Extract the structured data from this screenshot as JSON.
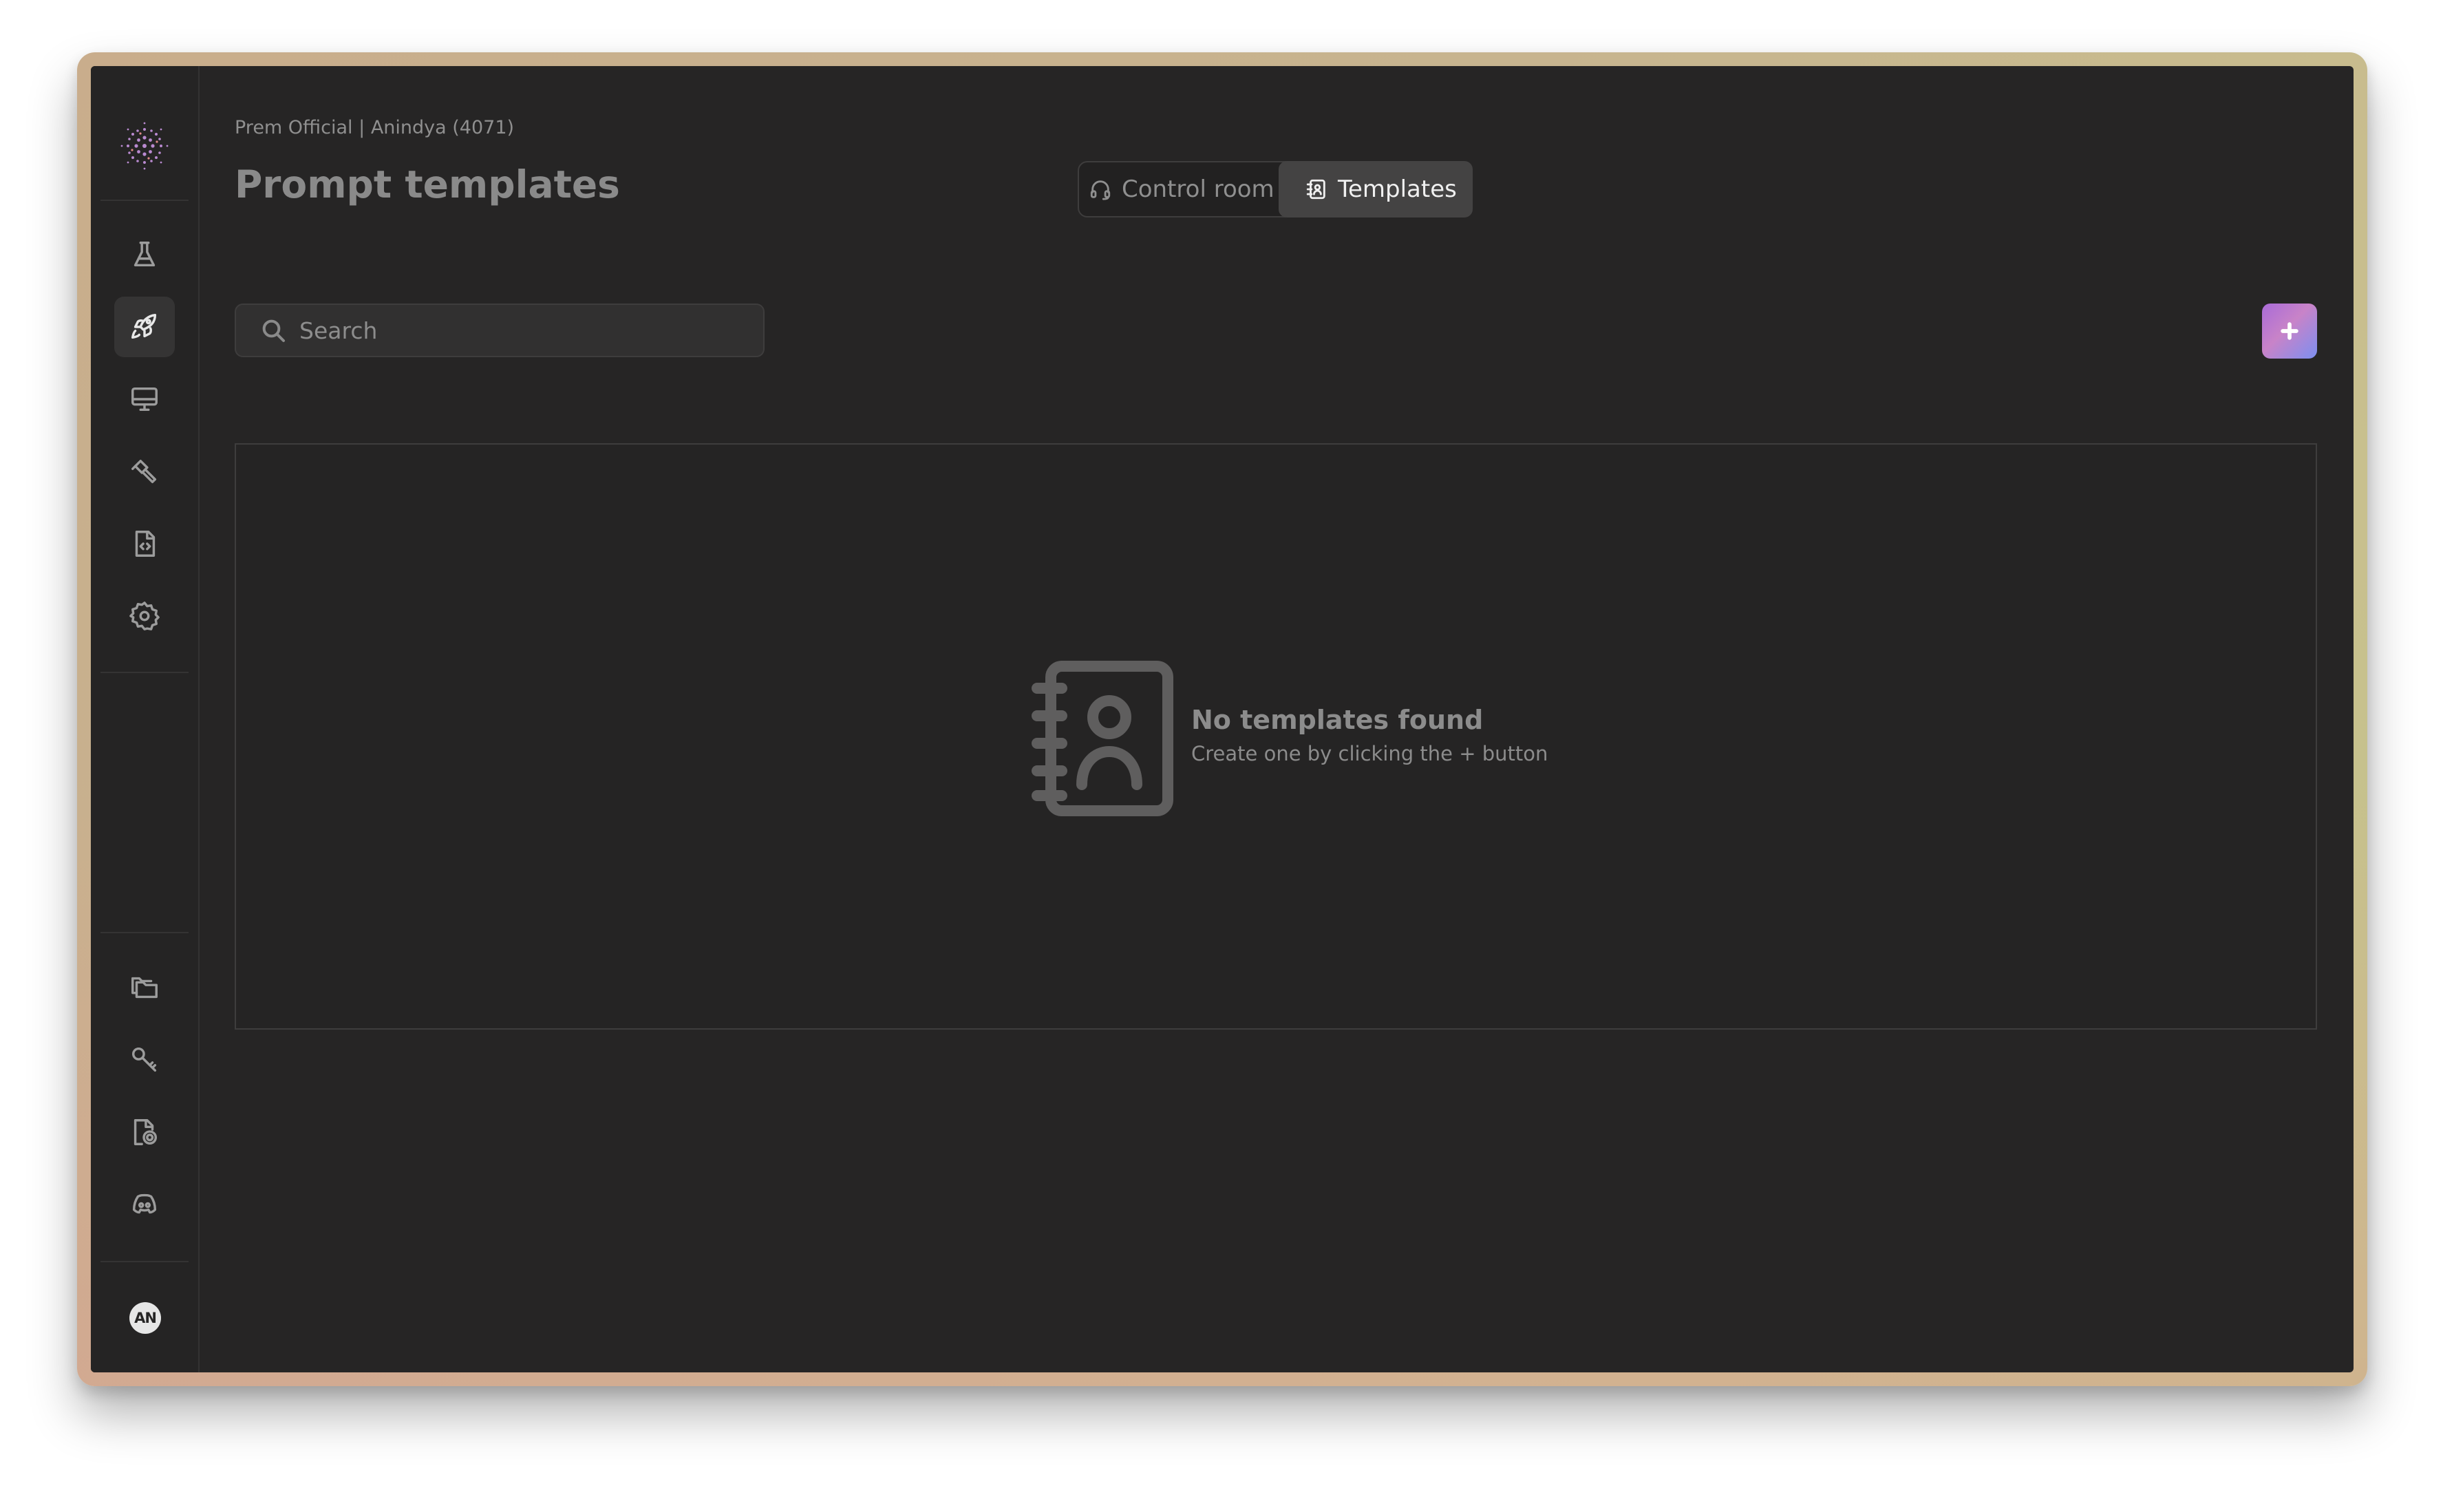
{
  "breadcrumb": "Prem Official | Anindya (4071)",
  "page_title": "Prompt templates",
  "tabs": [
    {
      "label": "Control room",
      "icon": "headset-icon",
      "active": false
    },
    {
      "label": "Templates",
      "icon": "contact-book-icon",
      "active": true
    }
  ],
  "search": {
    "placeholder": "Search",
    "value": ""
  },
  "add_button": {
    "icon": "plus-icon"
  },
  "empty_state": {
    "icon": "contact-book-icon",
    "title": "No templates found",
    "subtitle": "Create one by clicking the + button"
  },
  "sidebar": {
    "top_items": [
      {
        "icon": "flask-icon",
        "active": false
      },
      {
        "icon": "rocket-icon",
        "active": true
      },
      {
        "icon": "monitor-icon",
        "active": false
      },
      {
        "icon": "hammer-icon",
        "active": false
      },
      {
        "icon": "code-file-icon",
        "active": false
      },
      {
        "icon": "gear-icon",
        "active": false
      }
    ],
    "bottom_items": [
      {
        "icon": "folders-icon"
      },
      {
        "icon": "key-icon"
      },
      {
        "icon": "file-settings-icon"
      },
      {
        "icon": "discord-icon"
      }
    ],
    "avatar_initials": "AN"
  },
  "colors": {
    "background": "#262525",
    "active_tab": "#444343",
    "add_button_gradient": [
      "#a96bd8",
      "#7c8ff0"
    ]
  }
}
